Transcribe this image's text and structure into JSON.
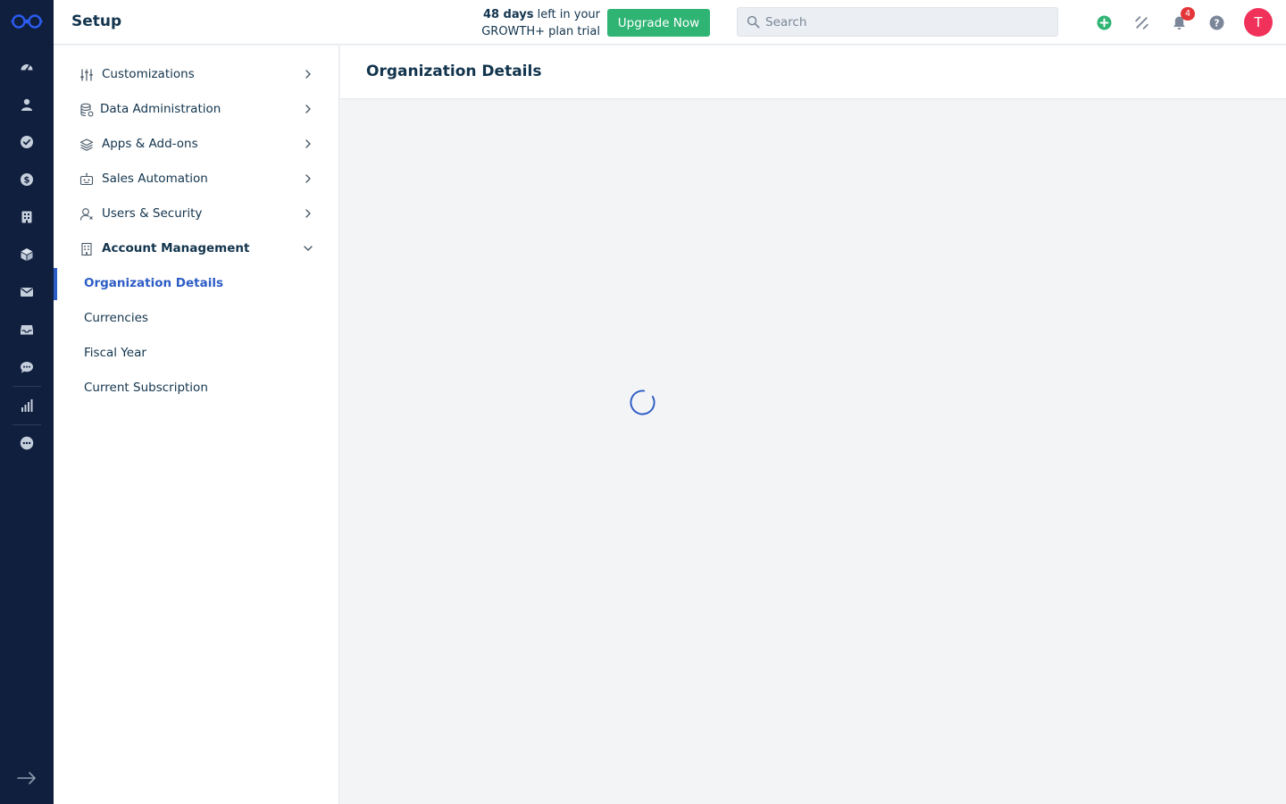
{
  "header": {
    "title": "Setup",
    "trial_days": "48 days",
    "trial_rest_line1": " left in your",
    "trial_line2": "GROWTH+ plan trial",
    "upgrade_label": "Upgrade Now",
    "search_placeholder": "Search",
    "notification_count": "4",
    "avatar_initial": "T"
  },
  "rail": {
    "items": [
      "dashboard-icon",
      "contacts-icon",
      "tasks-icon",
      "deals-icon",
      "accounts-icon",
      "products-icon",
      "email-icon",
      "inbox-icon",
      "chat-icon",
      "reports-icon",
      "more-icon"
    ]
  },
  "nav": {
    "sections": [
      {
        "label": "Customizations",
        "icon": "sliders-icon"
      },
      {
        "label": "Data Administration",
        "icon": "database-icon"
      },
      {
        "label": "Apps & Add-ons",
        "icon": "layers-icon"
      },
      {
        "label": "Sales Automation",
        "icon": "robot-icon"
      },
      {
        "label": "Users & Security",
        "icon": "user-icon"
      },
      {
        "label": "Account Management",
        "icon": "building-icon"
      }
    ],
    "account_items": [
      {
        "label": "Organization Details"
      },
      {
        "label": "Currencies"
      },
      {
        "label": "Fiscal Year"
      },
      {
        "label": "Current Subscription"
      }
    ]
  },
  "main": {
    "title": "Organization Details"
  },
  "colors": {
    "rail_bg": "#0f1f3d",
    "accent": "#2c5cc5",
    "upgrade_green": "#2fb474",
    "avatar_pink": "#f0325a",
    "badge_red": "#e43538"
  }
}
